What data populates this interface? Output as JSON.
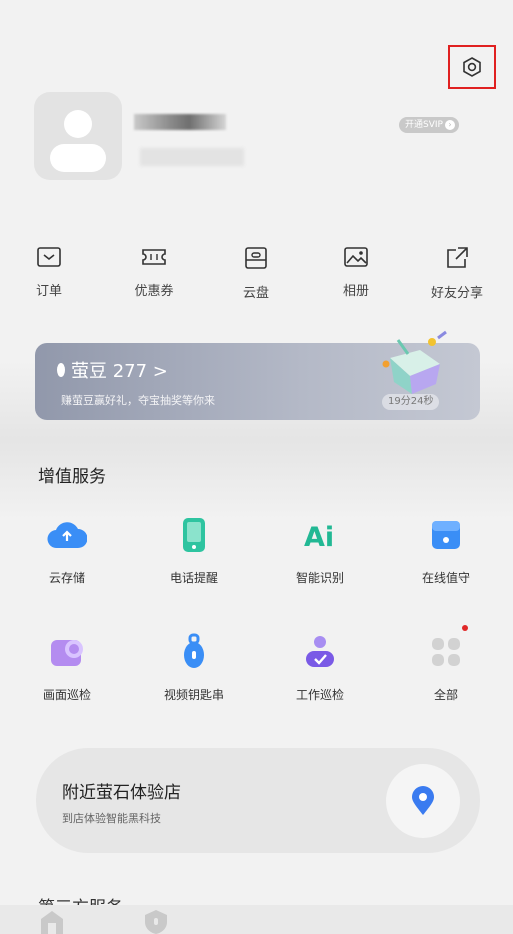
{
  "header": {
    "svip_label": "开通SVIP"
  },
  "quick_actions": [
    {
      "label": "订单",
      "icon": "order-icon"
    },
    {
      "label": "优惠券",
      "icon": "coupon-icon"
    },
    {
      "label": "云盘",
      "icon": "cloud-disk-icon"
    },
    {
      "label": "相册",
      "icon": "album-icon"
    },
    {
      "label": "好友分享",
      "icon": "share-icon"
    }
  ],
  "banner": {
    "title": "萤豆 277 >",
    "subtitle": "赚萤豆赢好礼，夺宝抽奖等你来",
    "timer": "19分24秒"
  },
  "value_services": {
    "title": "增值服务",
    "items": [
      {
        "label": "云存储",
        "icon": "cloud-storage-icon"
      },
      {
        "label": "电话提醒",
        "icon": "phone-reminder-icon"
      },
      {
        "label": "智能识别",
        "icon": "ai-recognition-icon"
      },
      {
        "label": "在线值守",
        "icon": "online-guard-icon"
      },
      {
        "label": "画面巡检",
        "icon": "screen-inspection-icon"
      },
      {
        "label": "视频钥匙串",
        "icon": "video-keychain-icon"
      },
      {
        "label": "工作巡检",
        "icon": "work-inspection-icon"
      },
      {
        "label": "全部",
        "icon": "all-icon"
      }
    ]
  },
  "store": {
    "title": "附近萤石体验店",
    "subtitle": "到店体验智能黑科技"
  },
  "third_party": {
    "title": "第三方服务"
  },
  "colors": {
    "accent_blue": "#3a8ef6",
    "banner": "#9aa0b2",
    "highlight_box": "#e02020"
  }
}
